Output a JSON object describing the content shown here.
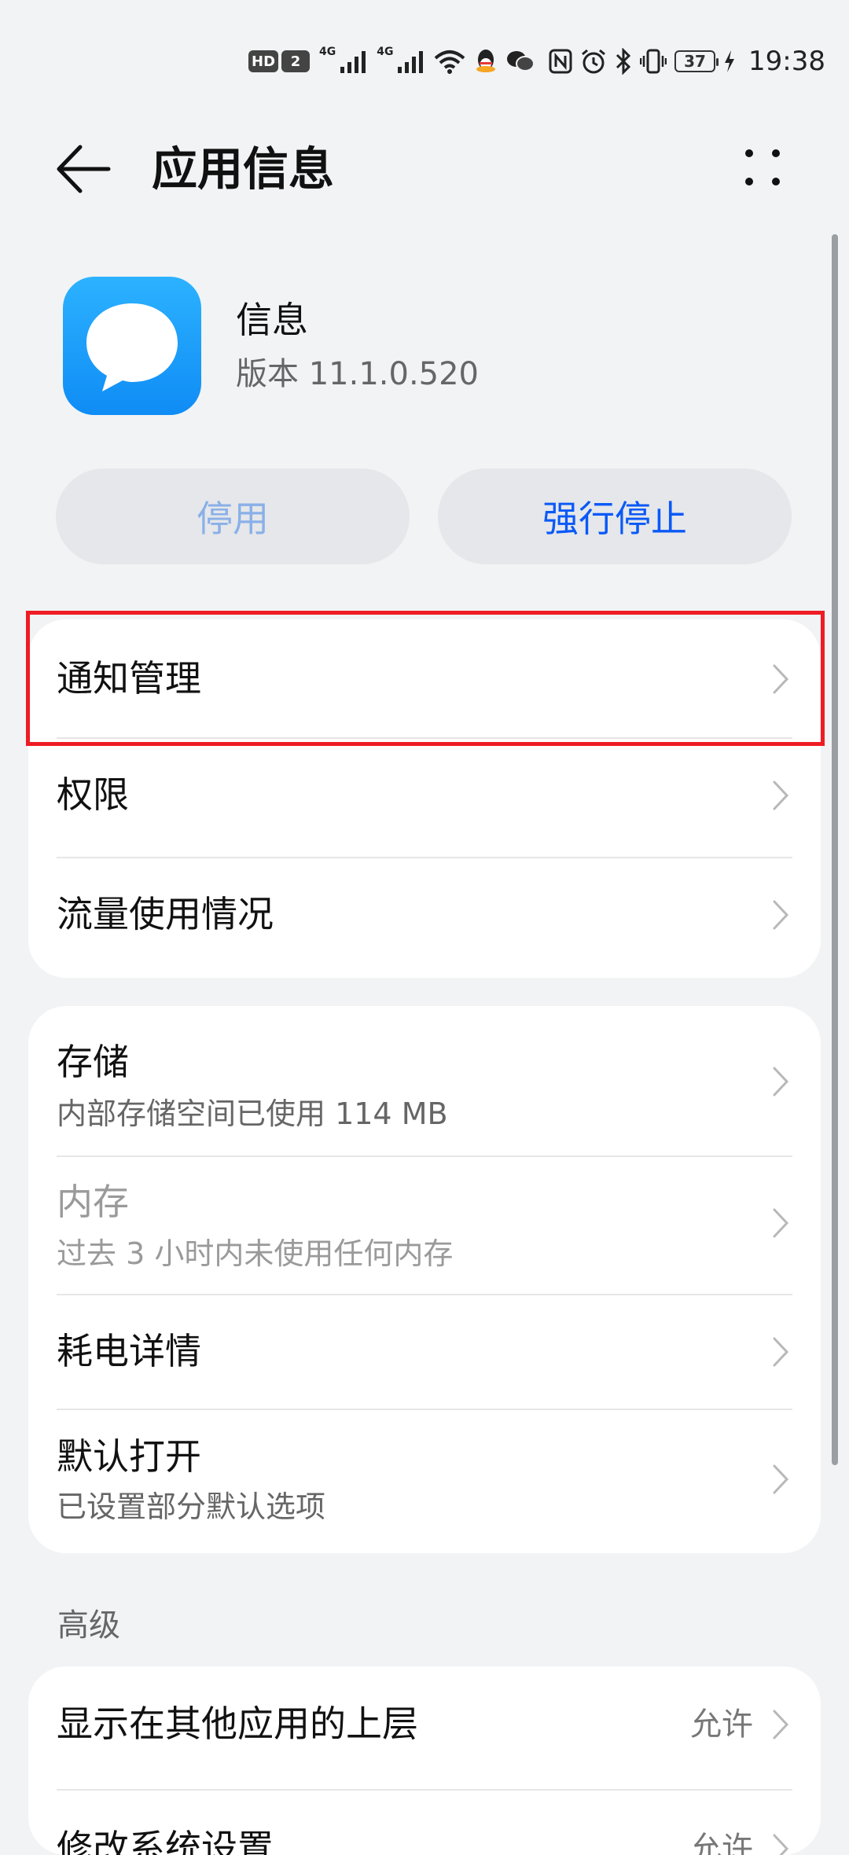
{
  "status_bar": {
    "hd_badge": "HD",
    "sim_badge": "2",
    "network_1": "4G",
    "network_2": "4G",
    "battery": "37",
    "time": "19:38",
    "icons": [
      "signal-icon",
      "signal-icon",
      "wifi-icon",
      "qq-icon",
      "wechat-icon",
      "nfc-icon",
      "alarm-icon",
      "bluetooth-icon",
      "vibrate-icon",
      "battery-icon",
      "charging-icon"
    ]
  },
  "header": {
    "title": "应用信息"
  },
  "app": {
    "name": "信息",
    "version": "版本 11.1.0.520",
    "icon_color": "#1a9cff"
  },
  "actions": {
    "disable_label": "停用",
    "force_stop_label": "强行停止",
    "accent": "#0a59f7"
  },
  "group1": [
    {
      "title": "通知管理"
    },
    {
      "title": "权限"
    },
    {
      "title": "流量使用情况"
    }
  ],
  "group2": [
    {
      "title": "存储",
      "subtitle": "内部存储空间已使用 114 MB"
    },
    {
      "title": "内存",
      "subtitle": "过去 3 小时内未使用任何内存"
    },
    {
      "title": "耗电详情"
    },
    {
      "title": "默认打开",
      "subtitle": "已设置部分默认选项"
    }
  ],
  "advanced": {
    "label": "高级",
    "items": [
      {
        "title": "显示在其他应用的上层",
        "value": "允许"
      },
      {
        "title": "修改系统设置",
        "value": "允许"
      }
    ]
  },
  "highlight_color": "#ee1c24"
}
